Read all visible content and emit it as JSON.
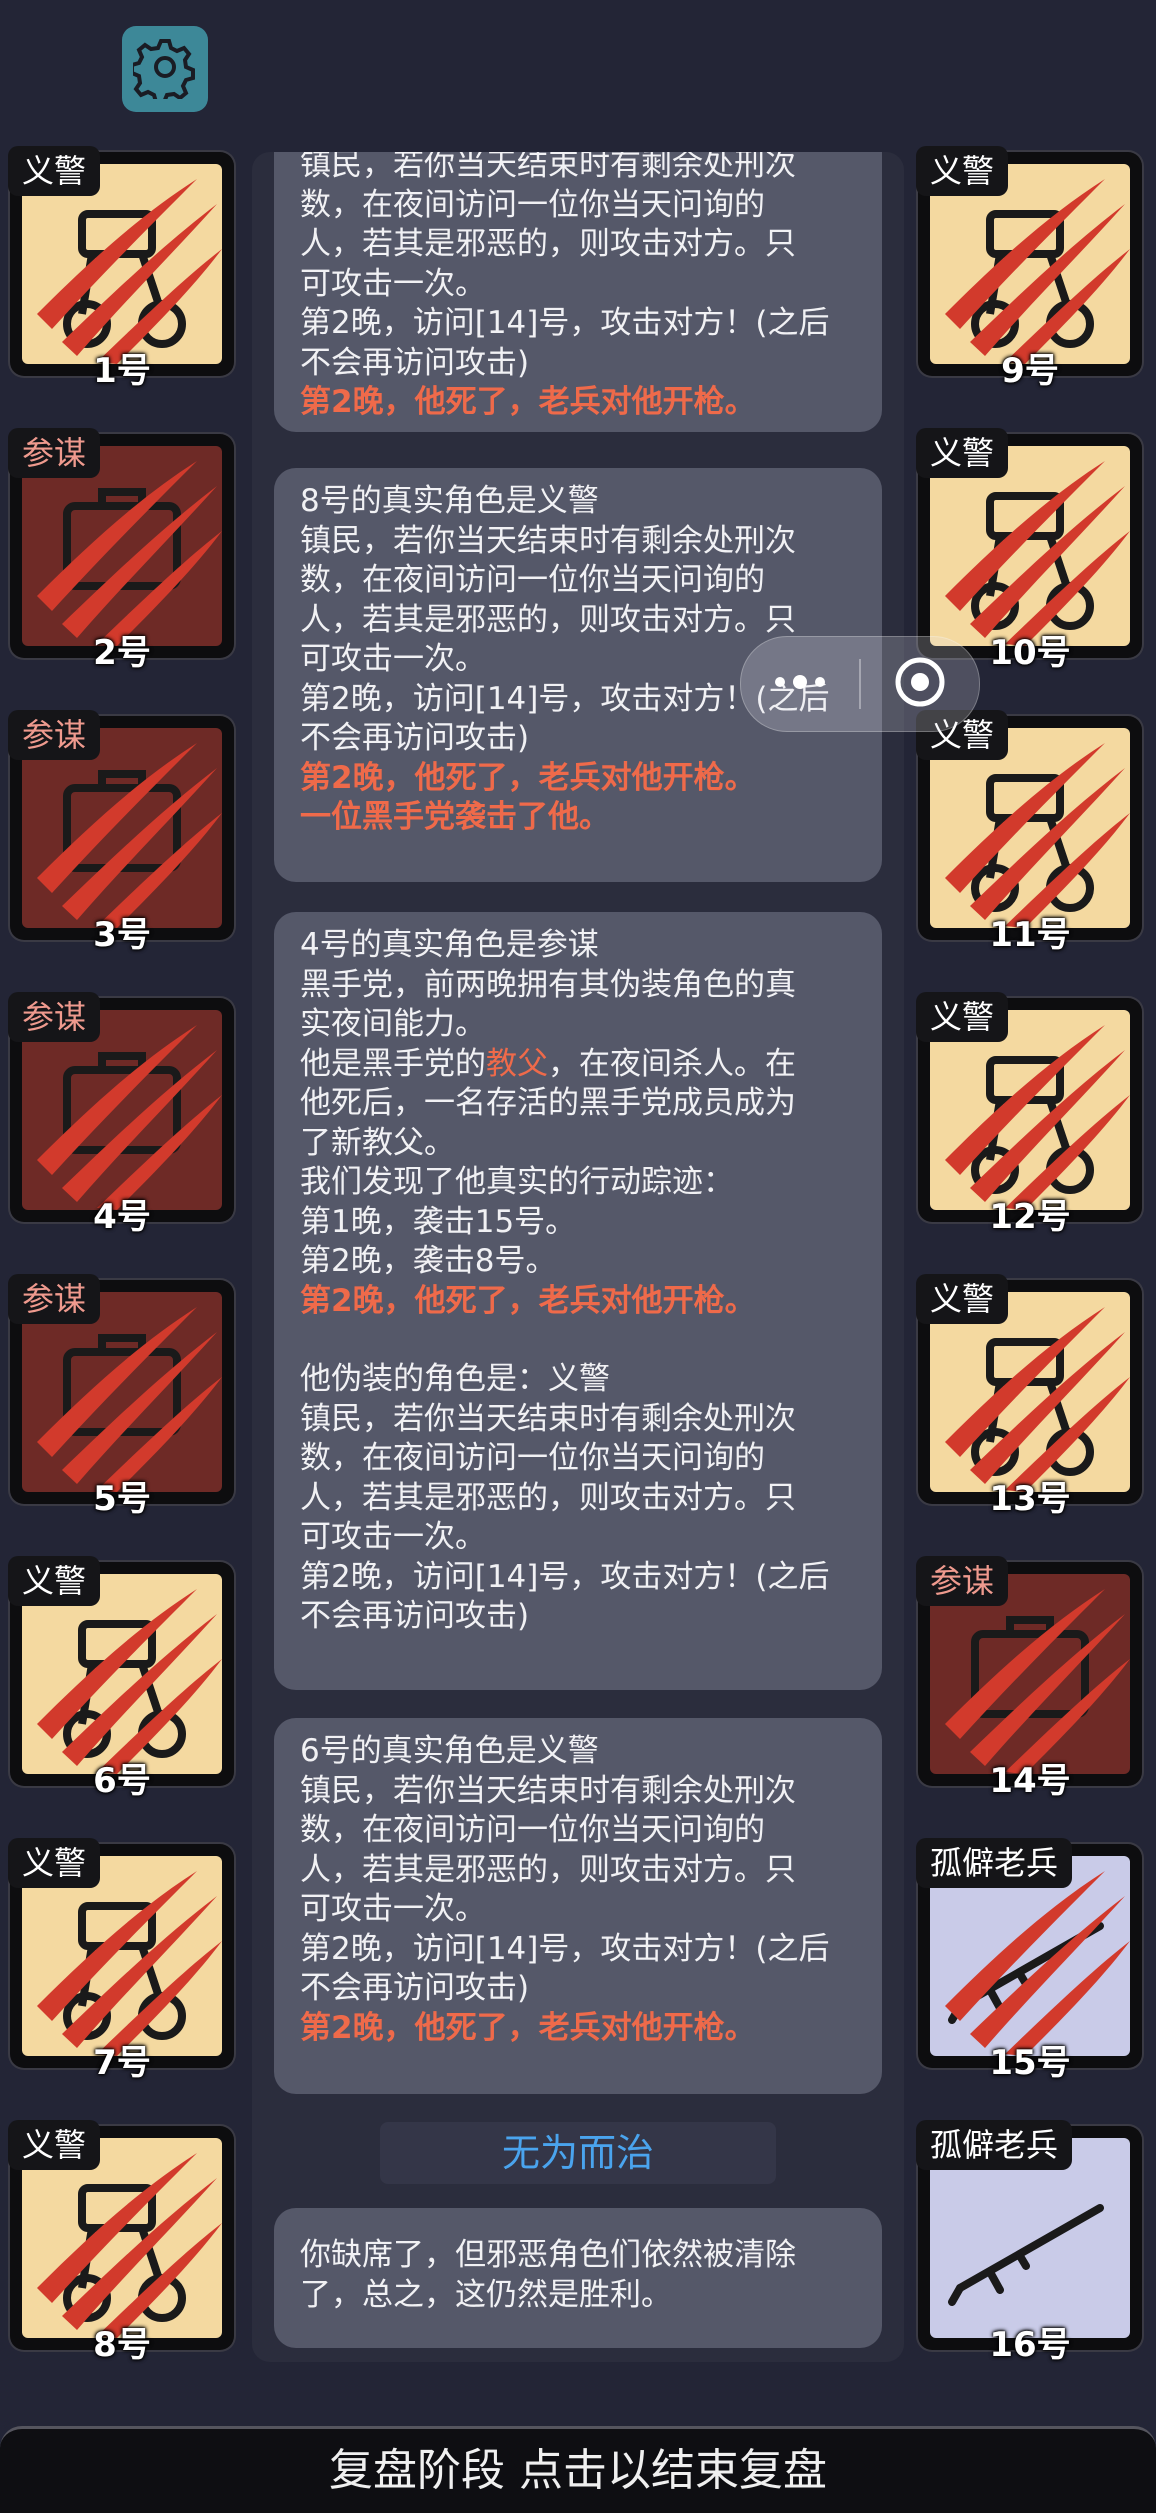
{
  "colors": {
    "background": "#232536",
    "vigilante_face": "#f4d9a0",
    "consigliere_face": "#6e2a26",
    "veteran_face": "#c9cbe8",
    "claw": "#d23a2c",
    "highlight_red": "#ef6a4a",
    "status_blue": "#4aa4ee"
  },
  "toolbar": {
    "settings_icon": "gear-icon"
  },
  "players_left": [
    {
      "role": "义警",
      "number": "1号",
      "kind": "vig",
      "icon": "handcuffs-icon",
      "claw": true
    },
    {
      "role": "参谋",
      "number": "2号",
      "kind": "con",
      "icon": "briefcase-icon",
      "claw": true
    },
    {
      "role": "参谋",
      "number": "3号",
      "kind": "con",
      "icon": "briefcase-icon",
      "claw": true
    },
    {
      "role": "参谋",
      "number": "4号",
      "kind": "con",
      "icon": "briefcase-icon",
      "claw": true
    },
    {
      "role": "参谋",
      "number": "5号",
      "kind": "con",
      "icon": "briefcase-icon",
      "claw": true
    },
    {
      "role": "义警",
      "number": "6号",
      "kind": "vig",
      "icon": "handcuffs-icon",
      "claw": true
    },
    {
      "role": "义警",
      "number": "7号",
      "kind": "vig",
      "icon": "handcuffs-icon",
      "claw": true
    },
    {
      "role": "义警",
      "number": "8号",
      "kind": "vig",
      "icon": "handcuffs-icon",
      "claw": true
    }
  ],
  "players_right": [
    {
      "role": "义警",
      "number": "9号",
      "kind": "vig",
      "icon": "handcuffs-icon",
      "claw": true
    },
    {
      "role": "义警",
      "number": "10号",
      "kind": "vig",
      "icon": "handcuffs-icon",
      "claw": true
    },
    {
      "role": "义警",
      "number": "11号",
      "kind": "vig",
      "icon": "handcuffs-icon",
      "claw": true
    },
    {
      "role": "义警",
      "number": "12号",
      "kind": "vig",
      "icon": "handcuffs-icon",
      "claw": true
    },
    {
      "role": "义警",
      "number": "13号",
      "kind": "vig",
      "icon": "handcuffs-icon",
      "claw": true
    },
    {
      "role": "参谋",
      "number": "14号",
      "kind": "con",
      "icon": "briefcase-icon",
      "claw": true
    },
    {
      "role": "孤僻老兵",
      "number": "15号",
      "kind": "vet",
      "icon": "rifle-icon",
      "claw": true
    },
    {
      "role": "孤僻老兵",
      "number": "16号",
      "kind": "vet",
      "icon": "rifle-icon",
      "claw": false
    }
  ],
  "log": {
    "p0": {
      "l1": "镇民，若你当天结束时有剩余处刑次",
      "l2": "数，在夜间访问一位你当天问询的",
      "l3": "人，若其是邪恶的，则攻击对方。只",
      "l4": "可攻击一次。",
      "l5": "第2晚，访问[14]号，攻击对方！(之后",
      "l6": "不会再访问攻击)",
      "r1": "第2晚，他死了，老兵对他开枪。"
    },
    "p1": {
      "l0": "8号的真实角色是义警",
      "l1": "镇民，若你当天结束时有剩余处刑次",
      "l2": "数，在夜间访问一位你当天问询的",
      "l3": "人，若其是邪恶的，则攻击对方。只",
      "l4": "可攻击一次。",
      "l5": "第2晚，访问[14]号，攻击对方！(之后",
      "l6": "不会再访问攻击)",
      "r1": "第2晚，他死了，老兵对他开枪。",
      "r2": "一位黑手党袭击了他。"
    },
    "p2": {
      "l0": "4号的真实角色是参谋",
      "l1": "黑手党，前两晚拥有其伪装角色的真",
      "l2": "实夜间能力。",
      "l3a": "他是黑手党的",
      "l3b": "教父",
      "l3c": "，在夜间杀人。在",
      "l4": "他死后，一名存活的黑手党成员成为",
      "l5": "了新教父。",
      "l6": "我们发现了他真实的行动踪迹：",
      "l7": "第1晚，袭击15号。",
      "l8": "第2晚，袭击8号。",
      "r1": "第2晚，他死了，老兵对他开枪。",
      "l9": "他伪装的角色是：义警",
      "l10": "镇民，若你当天结束时有剩余处刑次",
      "l11": "数，在夜间访问一位你当天问询的",
      "l12": "人，若其是邪恶的，则攻击对方。只",
      "l13": "可攻击一次。",
      "l14": "第2晚，访问[14]号，攻击对方！(之后",
      "l15": "不会再访问攻击)"
    },
    "p3": {
      "l0": "6号的真实角色是义警",
      "l1": "镇民，若你当天结束时有剩余处刑次",
      "l2": "数，在夜间访问一位你当天问询的",
      "l3": "人，若其是邪恶的，则攻击对方。只",
      "l4": "可攻击一次。",
      "l5": "第2晚，访问[14]号，攻击对方！(之后",
      "l6": "不会再访问攻击)",
      "r1": "第2晚，他死了，老兵对他开枪。"
    },
    "result_title": "无为而治",
    "p4": {
      "l1": "你缺席了，但邪恶角色们依然被清除",
      "l2": "了，总之，这仍然是胜利。"
    }
  },
  "mini_program": {
    "more_icon": "more-dots-icon",
    "close_icon": "target-close-icon"
  },
  "bottom_bar": {
    "label": "复盘阶段 点击以结束复盘"
  }
}
